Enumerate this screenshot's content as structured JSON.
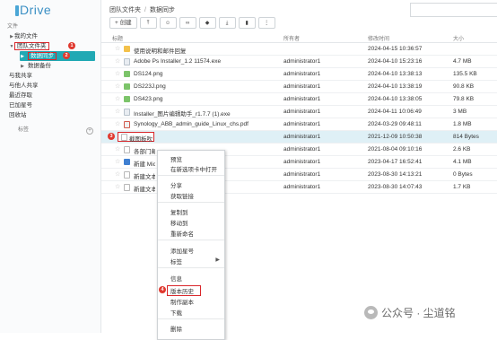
{
  "app": {
    "logo": "Drive"
  },
  "sidebar": {
    "section_label": "文件",
    "my_files": "我的文件",
    "team_folder": "团队文件夹",
    "data_sync": "数据同步",
    "data_backup": "数据备份",
    "shared_with_me": "与我共享",
    "shared_with_others": "与他人共享",
    "recent": "最近存取",
    "starred": "已加星号",
    "recycle_bin": "回收站",
    "tags_label": "标签",
    "badges": [
      "1",
      "2"
    ]
  },
  "breadcrumb": {
    "root": "团队文件夹",
    "current": "数据同步",
    "separator": "/"
  },
  "toolbar": {
    "create_label": "创建"
  },
  "table": {
    "headers": {
      "name": "标题",
      "owner": "所有者",
      "modified": "修改时间",
      "size": "大小"
    },
    "rows": [
      {
        "name": "使用说明和邮件回复",
        "owner": "",
        "modified": "2024-04-15 10:36:57",
        "size": "",
        "type": "folder"
      },
      {
        "name": "Adobe Ps Installer_1.2 11574.exe",
        "owner": "administrator1",
        "modified": "2024-04-10 15:23:16",
        "size": "4.7 MB",
        "type": "exe"
      },
      {
        "name": "DS124.png",
        "owner": "administrator1",
        "modified": "2024-04-10 13:38:13",
        "size": "135.5 KB",
        "type": "png"
      },
      {
        "name": "DS223J.png",
        "owner": "administrator1",
        "modified": "2024-04-10 13:38:19",
        "size": "90.8 KB",
        "type": "png"
      },
      {
        "name": "DS423.png",
        "owner": "administrator1",
        "modified": "2024-04-10 13:38:05",
        "size": "79.8 KB",
        "type": "png"
      },
      {
        "name": "Installer_图片编辑助手_r1.7.7 (1).exe",
        "owner": "administrator1",
        "modified": "2024-04-11 10:06:49",
        "size": "3 MB",
        "type": "exe"
      },
      {
        "name": "Synology_ABB_admin_guide_Linux_chs.pdf",
        "owner": "administrator1",
        "modified": "2024-03-29 09:48:11",
        "size": "1.8 MB",
        "type": "pdf"
      },
      {
        "name": "截图板吹",
        "owner": "administrator1",
        "modified": "2021-12-09 10:50:38",
        "size": "814 Bytes",
        "type": "txt"
      },
      {
        "name": "各部门邮",
        "owner": "administrator1",
        "modified": "2021-08-04 09:10:16",
        "size": "2.6 KB",
        "type": "txt"
      },
      {
        "name": "新建 Mic",
        "owner": "administrator1",
        "modified": "2023-04-17 16:52:41",
        "size": "4.1 MB",
        "type": "doc"
      },
      {
        "name": "新建文本",
        "owner": "administrator1",
        "modified": "2023-08-30 14:13:21",
        "size": "0 Bytes",
        "type": "txt"
      },
      {
        "name": "新建文本",
        "owner": "administrator1",
        "modified": "2023-08-30 14:07:43",
        "size": "1.7 KB",
        "type": "txt"
      }
    ],
    "selected_badge": "3"
  },
  "context_menu": {
    "items": [
      "预览",
      "在新选项卡中打开",
      "分享",
      "获取链接",
      "复制到",
      "移动到",
      "重新命名",
      "添加星号",
      "标签",
      "信息",
      "版本历史",
      "制作副本",
      "下载",
      "删除"
    ],
    "badge": "4"
  },
  "watermark": {
    "text": "公众号 · 尘道铭"
  }
}
